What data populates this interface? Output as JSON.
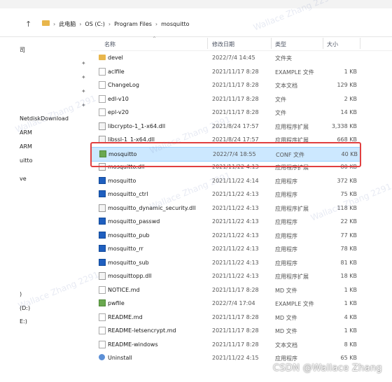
{
  "breadcrumb": {
    "items": [
      "此电脑",
      "OS (C:)",
      "Program Files",
      "mosquitto"
    ]
  },
  "sidebar": {
    "items": [
      "司",
      "NetdiskDownload",
      "ARM",
      "ARM",
      "uitto",
      "ve",
      ")",
      "(D:)",
      "E:)"
    ]
  },
  "columns": {
    "name": "名称",
    "date": "修改日期",
    "type": "类型",
    "size": "大小"
  },
  "files": [
    {
      "name": "devel",
      "date": "2022/7/4 14:45",
      "type": "文件夹",
      "size": "",
      "icon": "folder-icon"
    },
    {
      "name": "aclfile",
      "date": "2021/11/17 8:28",
      "type": "EXAMPLE 文件",
      "size": "1 KB",
      "icon": "file-icon"
    },
    {
      "name": "ChangeLog",
      "date": "2021/11/17 8:28",
      "type": "文本文档",
      "size": "129 KB",
      "icon": "file-icon"
    },
    {
      "name": "edl-v10",
      "date": "2021/11/17 8:28",
      "type": "文件",
      "size": "2 KB",
      "icon": "file-icon"
    },
    {
      "name": "epl-v20",
      "date": "2021/11/17 8:28",
      "type": "文件",
      "size": "14 KB",
      "icon": "file-icon"
    },
    {
      "name": "libcrypto-1_1-x64.dll",
      "date": "2021/8/24 17:57",
      "type": "应用程序扩展",
      "size": "3,338 KB",
      "icon": "dll-icon"
    },
    {
      "name": "libssl-1_1-x64.dll",
      "date": "2021/8/24 17:57",
      "type": "应用程序扩展",
      "size": "668 KB",
      "icon": "dll-icon"
    },
    {
      "name": "mosquitto",
      "date": "2022/7/4 18:55",
      "type": "CONF 文件",
      "size": "40 KB",
      "icon": "config-file-icon",
      "selected": true
    },
    {
      "name": "mosquitto.dll",
      "date": "2021/11/22 4:13",
      "type": "应用程序扩展",
      "size": "80 KB",
      "icon": "dll-icon"
    },
    {
      "name": "mosquitto",
      "date": "2021/11/22 4:14",
      "type": "应用程序",
      "size": "372 KB",
      "icon": "exe-icon"
    },
    {
      "name": "mosquitto_ctrl",
      "date": "2021/11/22 4:13",
      "type": "应用程序",
      "size": "75 KB",
      "icon": "exe-icon"
    },
    {
      "name": "mosquitto_dynamic_security.dll",
      "date": "2021/11/22 4:13",
      "type": "应用程序扩展",
      "size": "118 KB",
      "icon": "dll-icon"
    },
    {
      "name": "mosquitto_passwd",
      "date": "2021/11/22 4:13",
      "type": "应用程序",
      "size": "22 KB",
      "icon": "exe-icon"
    },
    {
      "name": "mosquitto_pub",
      "date": "2021/11/22 4:13",
      "type": "应用程序",
      "size": "77 KB",
      "icon": "exe-icon"
    },
    {
      "name": "mosquitto_rr",
      "date": "2021/11/22 4:13",
      "type": "应用程序",
      "size": "78 KB",
      "icon": "exe-icon"
    },
    {
      "name": "mosquitto_sub",
      "date": "2021/11/22 4:13",
      "type": "应用程序",
      "size": "81 KB",
      "icon": "exe-icon"
    },
    {
      "name": "mosquittopp.dll",
      "date": "2021/11/22 4:13",
      "type": "应用程序扩展",
      "size": "18 KB",
      "icon": "dll-icon"
    },
    {
      "name": "NOTICE.md",
      "date": "2021/11/17 8:28",
      "type": "MD 文件",
      "size": "1 KB",
      "icon": "file-icon"
    },
    {
      "name": "pwfile",
      "date": "2022/7/4 17:04",
      "type": "EXAMPLE 文件",
      "size": "1 KB",
      "icon": "config-file-icon"
    },
    {
      "name": "README.md",
      "date": "2021/11/17 8:28",
      "type": "MD 文件",
      "size": "4 KB",
      "icon": "file-icon"
    },
    {
      "name": "README-letsencrypt.md",
      "date": "2021/11/17 8:28",
      "type": "MD 文件",
      "size": "1 KB",
      "icon": "file-icon"
    },
    {
      "name": "README-windows",
      "date": "2021/11/17 8:28",
      "type": "文本文档",
      "size": "8 KB",
      "icon": "file-icon"
    },
    {
      "name": "Uninstall",
      "date": "2021/11/22 4:15",
      "type": "应用程序",
      "size": "65 KB",
      "icon": "uninstall-icon"
    }
  ],
  "watermark": {
    "text": "Wallace Zhang 2291"
  },
  "footer": {
    "credit": "CSDN @Wallace Zhang"
  },
  "colors": {
    "selection": "#cce8ff",
    "highlight_box": "#e04040",
    "folder": "#e8b64c"
  }
}
